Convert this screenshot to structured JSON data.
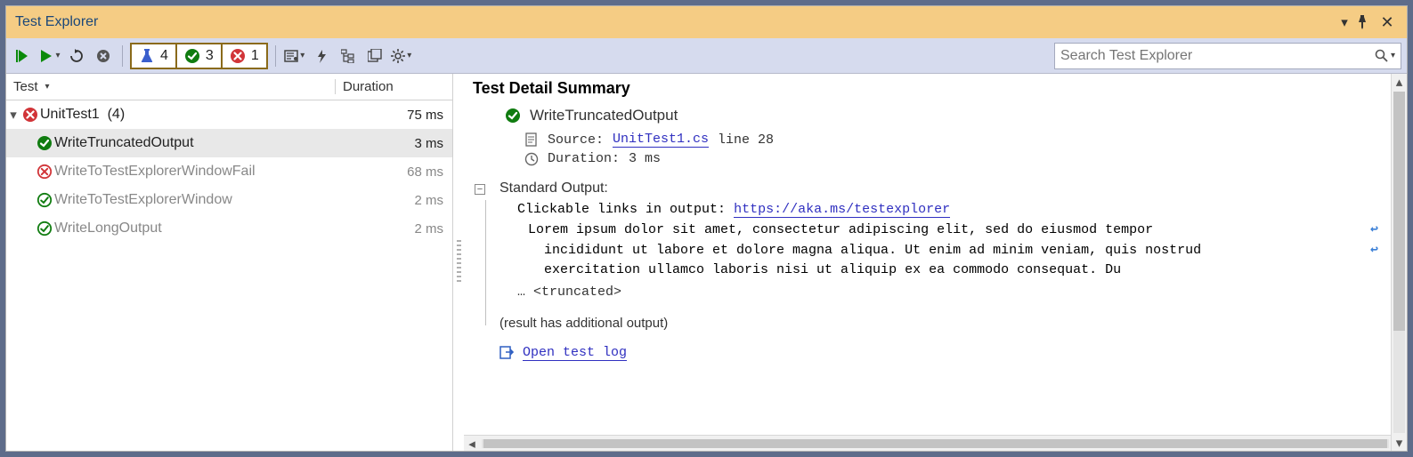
{
  "window": {
    "title": "Test Explorer"
  },
  "search": {
    "placeholder": "Search Test Explorer"
  },
  "counters": {
    "total": "4",
    "passed": "3",
    "failed": "1"
  },
  "columns": {
    "test": "Test",
    "duration": "Duration"
  },
  "tree": {
    "group": {
      "name": "UnitTest1",
      "count": "(4)",
      "duration": "75 ms",
      "status": "fail"
    },
    "items": [
      {
        "name": "WriteTruncatedOutput",
        "duration": "3 ms",
        "status": "pass",
        "selected": true,
        "grey": false
      },
      {
        "name": "WriteToTestExplorerWindowFail",
        "duration": "68 ms",
        "status": "fail-outline",
        "selected": false,
        "grey": true
      },
      {
        "name": "WriteToTestExplorerWindow",
        "duration": "2 ms",
        "status": "pass-outline",
        "selected": false,
        "grey": true
      },
      {
        "name": "WriteLongOutput",
        "duration": "2 ms",
        "status": "pass-outline",
        "selected": false,
        "grey": true
      }
    ]
  },
  "detail": {
    "heading": "Test Detail Summary",
    "testName": "WriteTruncatedOutput",
    "sourceLabel": "Source:",
    "sourceFile": "UnitTest1.cs",
    "sourceLine": "line 28",
    "durationLabel": "Duration:",
    "durationValue": "3 ms",
    "stdOutputLabel": "Standard Output:",
    "outputPrefix": "Clickable links in output:",
    "outputLink": "https://aka.ms/testexplorer",
    "lorem1": "Lorem ipsum dolor sit amet, consectetur adipiscing elit, sed do eiusmod tempor",
    "lorem2": "incididunt ut labore et dolore magna aliqua. Ut enim ad minim veniam, quis nostrud",
    "lorem3": "exercitation ullamco laboris nisi ut aliquip ex ea commodo consequat. Du",
    "truncated": "… <truncated>",
    "additional": "(result has additional output)",
    "openLog": "Open test log"
  }
}
